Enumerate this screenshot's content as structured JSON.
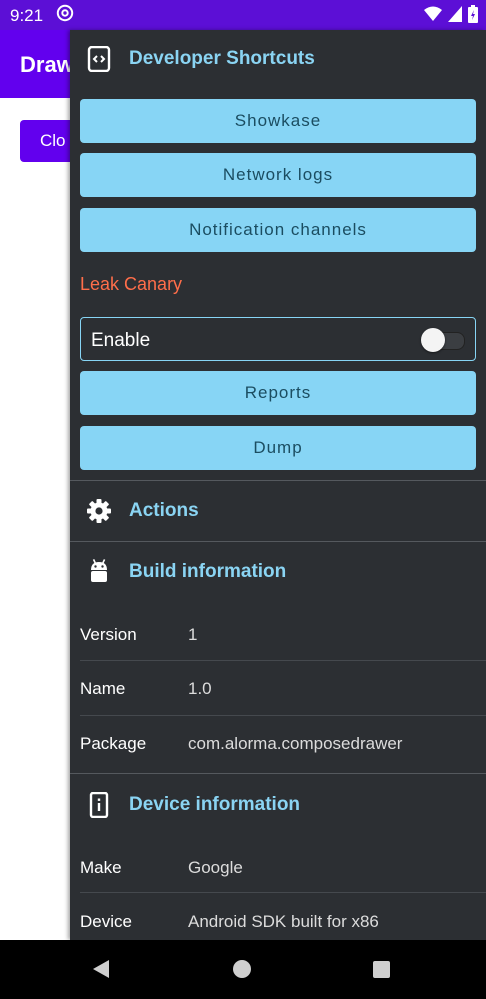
{
  "status_bar": {
    "time": "9:21",
    "icons": [
      "at-icon",
      "wifi-icon",
      "signal-icon",
      "battery-icon"
    ]
  },
  "app": {
    "title": "Draw",
    "button_label": "Clo",
    "accent_color": "#6200ee"
  },
  "drawer": {
    "developer": {
      "title": "Developer Shortcuts",
      "icon": "developer-mode-icon",
      "buttons": [
        {
          "label": "Showkase"
        },
        {
          "label": "Network logs"
        },
        {
          "label": "Notification channels"
        }
      ]
    },
    "leak_canary": {
      "title": "Leak Canary",
      "enable_label": "Enable",
      "enabled": false,
      "buttons": [
        {
          "label": "Reports"
        },
        {
          "label": "Dump"
        }
      ]
    },
    "actions": {
      "title": "Actions",
      "icon": "gear-icon"
    },
    "build": {
      "title": "Build information",
      "icon": "android-icon",
      "rows": [
        {
          "label": "Version",
          "value": "1"
        },
        {
          "label": "Name",
          "value": "1.0"
        },
        {
          "label": "Package",
          "value": "com.alorma.composedrawer"
        }
      ]
    },
    "device": {
      "title": "Device information",
      "icon": "phone-info-icon",
      "rows": [
        {
          "label": "Make",
          "value": "Google"
        },
        {
          "label": "Device",
          "value": "Android SDK built for x86"
        }
      ]
    },
    "colors": {
      "background": "#2c2f33",
      "section_title": "#8ad4f3",
      "button": "#87d5f5",
      "leak_title": "#ff6e4a"
    }
  },
  "nav_bar": {
    "icons": [
      "back-icon",
      "home-icon",
      "recents-icon"
    ]
  }
}
